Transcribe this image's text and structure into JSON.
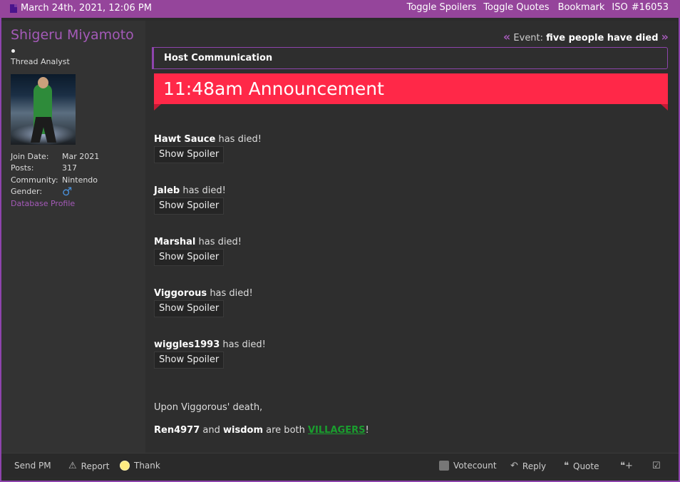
{
  "topbar": {
    "date": "March 24th, 2021, 12:06 PM",
    "toggle_spoilers": "Toggle Spoilers",
    "toggle_quotes": "Toggle Quotes",
    "bookmark": "Bookmark",
    "iso": "ISO",
    "post_number": "#16053"
  },
  "user": {
    "name": "Shigeru Miyamoto",
    "title": "Thread Analyst",
    "join_date_label": "Join Date:",
    "join_date": "Mar 2021",
    "posts_label": "Posts:",
    "posts": "317",
    "community_label": "Community:",
    "community": "Nintendo",
    "gender_label": "Gender:",
    "gender_symbol": "♂",
    "database_profile": "Database Profile"
  },
  "post": {
    "event_label": "Event:",
    "event_value": "five people have died",
    "host_box": "Host Communication",
    "announcement": "11:48am Announcement",
    "deaths": [
      {
        "name": "Hawt Sauce",
        "text": "has died!",
        "button": "Show Spoiler"
      },
      {
        "name": "Jaleb",
        "text": "has died!",
        "button": "Show Spoiler"
      },
      {
        "name": "Marshal",
        "text": "has died!",
        "button": "Show Spoiler"
      },
      {
        "name": "Viggorous",
        "text": "has died!",
        "button": "Show Spoiler"
      },
      {
        "name": "wiggles1993",
        "text": "has died!",
        "button": "Show Spoiler"
      }
    ],
    "note_line1": "Upon Viggorous' death,",
    "note_name1": "Ren4977",
    "note_and": "and",
    "note_name2": "wisdom",
    "note_are_both": "are both",
    "note_role": "VILLAGERS",
    "note_end": "!"
  },
  "bottombar": {
    "send_pm": "Send PM",
    "report": "Report",
    "thank": "Thank",
    "votecount": "Votecount",
    "reply": "Reply",
    "quote": "Quote"
  },
  "colors": {
    "accent": "#95459b",
    "banner": "#ff2848",
    "villagers": "#1a9e2e"
  }
}
